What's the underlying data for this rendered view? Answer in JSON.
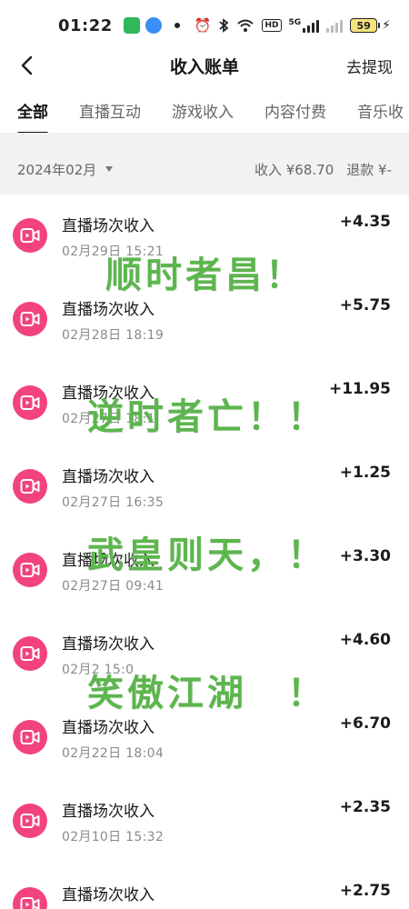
{
  "status_bar": {
    "time": "01:22",
    "network_label": "5G",
    "battery": "59",
    "icons": [
      "green-app-icon",
      "blue-app-icon",
      "alarm-icon",
      "bluetooth-icon",
      "wifi-icon",
      "hd-icon",
      "signal-icon",
      "battery-icon",
      "charging-icon"
    ]
  },
  "header": {
    "title": "收入账单",
    "action": "去提现",
    "back_icon": "chevron-left-icon"
  },
  "tabs": [
    "全部",
    "直播互动",
    "游戏收入",
    "内容付费",
    "音乐收"
  ],
  "month_header": {
    "month": "2024年02月",
    "income": "收入 ¥68.70",
    "refund": "退款 ¥-"
  },
  "transactions": [
    {
      "title": "直播场次收入",
      "time": "02月29日 15:21",
      "amount": "+4.35"
    },
    {
      "title": "直播场次收入",
      "time": "02月28日 18:19",
      "amount": "+5.75"
    },
    {
      "title": "直播场次收入",
      "time": "02月27日 18:1",
      "amount": "+11.95"
    },
    {
      "title": "直播场次收入",
      "time": "02月27日 16:35",
      "amount": "+1.25"
    },
    {
      "title": "直播场次收入",
      "time": "02月27日 09:41",
      "amount": "+3.30"
    },
    {
      "title": "直播场次收入",
      "time": "02月2 15:0",
      "amount": "+4.60"
    },
    {
      "title": "直播场次收入",
      "time": "02月22日 18:04",
      "amount": "+6.70"
    },
    {
      "title": "直播场次收入",
      "time": "02月10日 15:32",
      "amount": "+2.35"
    },
    {
      "title": "直播场次收入",
      "time": "",
      "amount": "+2.75"
    }
  ],
  "overlay_text": [
    "顺时者昌！",
    "逆时者亡！！",
    "武皇则天，！",
    "笑傲江湖　！"
  ],
  "colors": {
    "accent_pink": "#f2437e",
    "overlay_green": "#5db54e",
    "month_bar_bg": "#f2f2f2"
  }
}
